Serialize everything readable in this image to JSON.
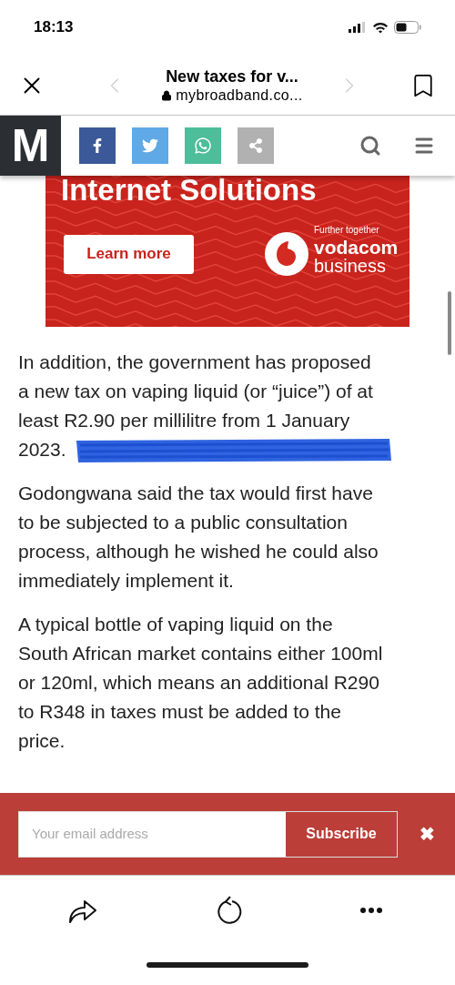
{
  "status_bar": {
    "time": "18:13"
  },
  "browser_bar": {
    "title": "New taxes for v...",
    "url": "mybroadband.co...",
    "back_disabled": true,
    "forward_disabled": true
  },
  "site_header": {
    "logo": "M",
    "share_buttons": [
      {
        "kind": "facebook",
        "color": "#3b5998"
      },
      {
        "kind": "twitter",
        "color": "#5ea9e6"
      },
      {
        "kind": "whatsapp",
        "color": "#4dbd9a"
      },
      {
        "kind": "share",
        "color": "#b1b1b1"
      }
    ]
  },
  "ad": {
    "headline": "Internet Solutions",
    "button": "Learn more",
    "tagline": "Further together",
    "brand": "vodacom",
    "brand_sub": "business"
  },
  "article": {
    "paragraphs": [
      {
        "lines": [
          "In addition, the government has proposed",
          "a new tax on vaping liquid (or “juice”) of at",
          "least R2.90 per millilitre from 1 January",
          "2023."
        ],
        "redacted": true
      },
      {
        "lines": [
          "Godongwana said the tax would first have",
          "to be subjected to a public consultation",
          "process, although he wished he could also",
          "immediately implement it."
        ],
        "redacted": false
      },
      {
        "lines": [
          "A typical bottle of vaping liquid on the",
          "South African market contains either 100ml",
          "or 120ml, which means an additional R290",
          "to R348 in taxes must be added to the",
          "price."
        ],
        "redacted": false
      }
    ]
  },
  "subscribe_bar": {
    "placeholder": "Your email address",
    "button": "Subscribe",
    "close": "✖"
  }
}
